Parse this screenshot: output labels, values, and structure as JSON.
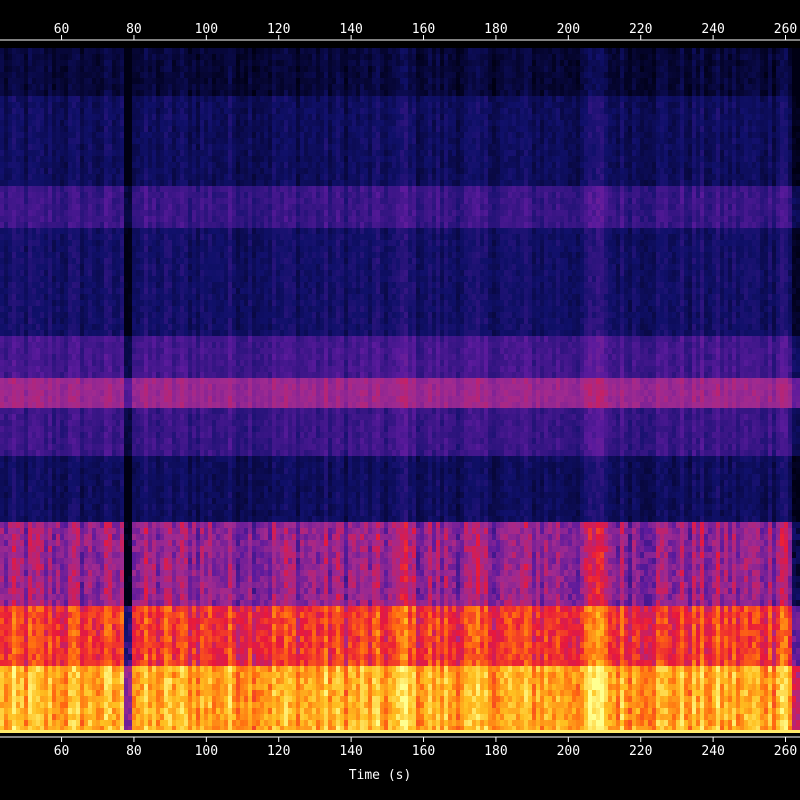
{
  "chart_data": {
    "type": "heatmap",
    "title": "",
    "xlabel": "Time (s)",
    "ylabel": "",
    "xlim": [
      43,
      264
    ],
    "xticks": [
      60,
      80,
      100,
      120,
      140,
      160,
      180,
      200,
      220,
      240,
      260
    ],
    "tick_labels": [
      "60",
      "80",
      "100",
      "120",
      "140",
      "160",
      "180",
      "200",
      "220",
      "240",
      "260"
    ],
    "colormap": [
      "#000014",
      "#10106a",
      "#5a1a9c",
      "#a02a90",
      "#e8183c",
      "#ff6a10",
      "#ffc020",
      "#ffff90"
    ],
    "background": "#000000",
    "axis_color": "#ffffff",
    "band_levels": [
      {
        "from": 1.0,
        "to": 0.93,
        "level": 0.06
      },
      {
        "from": 0.93,
        "to": 0.8,
        "level": 0.12
      },
      {
        "from": 0.8,
        "to": 0.74,
        "level": 0.22
      },
      {
        "from": 0.74,
        "to": 0.58,
        "level": 0.14
      },
      {
        "from": 0.58,
        "to": 0.52,
        "level": 0.24
      },
      {
        "from": 0.52,
        "to": 0.47,
        "level": 0.42
      },
      {
        "from": 0.47,
        "to": 0.4,
        "level": 0.22
      },
      {
        "from": 0.4,
        "to": 0.31,
        "level": 0.12
      },
      {
        "from": 0.31,
        "to": 0.18,
        "level": 0.4
      },
      {
        "from": 0.18,
        "to": 0.1,
        "level": 0.62
      },
      {
        "from": 0.1,
        "to": 0.0,
        "level": 0.82
      }
    ],
    "quiet_segments_s": [
      [
        77,
        79
      ],
      [
        262,
        264
      ]
    ],
    "loud_segments_s": [
      [
        153,
        157
      ],
      [
        205,
        211
      ],
      [
        257,
        261
      ]
    ]
  }
}
